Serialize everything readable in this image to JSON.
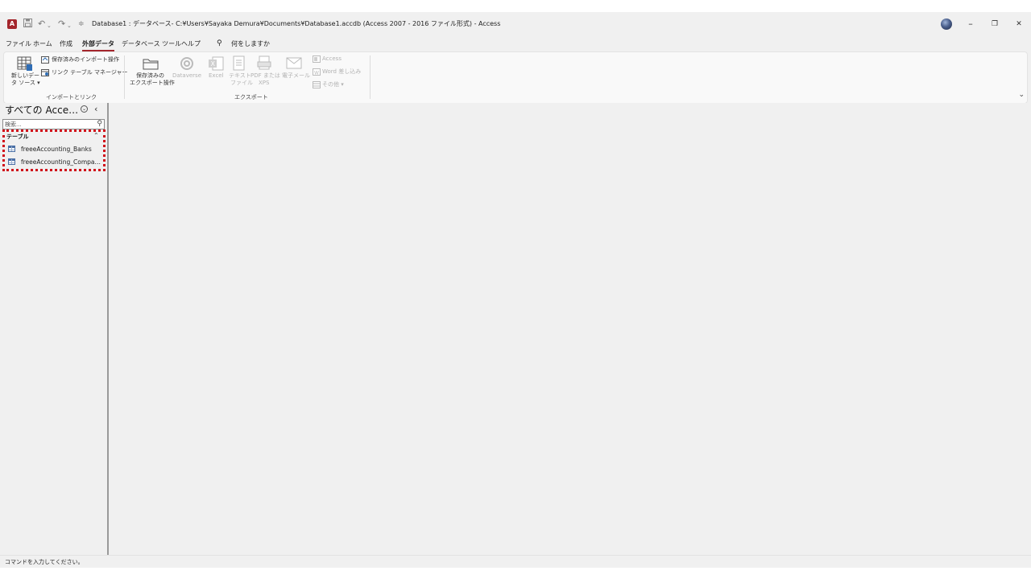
{
  "window": {
    "title": "Database1 : データベース- C:¥Users¥Sayaka Demura¥Documents¥Database1.accdb (Access 2007 - 2016 ファイル形式)  -  Access",
    "app_icon_letter": "A",
    "min_icon": "–",
    "restore_icon": "❐",
    "close_icon": "✕"
  },
  "quick_access": {
    "save_icon": "save-icon",
    "undo_icon": "undo-icon",
    "redo_icon": "redo-icon",
    "customize_icon": "customize-icon"
  },
  "menu": {
    "tabs": [
      {
        "label": "ファイル"
      },
      {
        "label": "ホーム"
      },
      {
        "label": "作成"
      },
      {
        "label": "外部データ"
      },
      {
        "label": "データベース ツール"
      },
      {
        "label": "ヘルプ"
      }
    ],
    "active_tab": "外部データ",
    "search_label": "何をしますか"
  },
  "ribbon": {
    "import_group": {
      "new_source_line1": "新しいデー",
      "new_source_line2": "タ ソース ▾",
      "saved_imports": "保存済みのインポート操作",
      "linked_table_manager": "リンク テーブル マネージャー",
      "label": "インポートとリンク"
    },
    "export_group": {
      "saved_exports_line1": "保存済みの",
      "saved_exports_line2": "エクスポート操作",
      "dataverse": "Dataverse",
      "excel": "Excel",
      "text_line1": "テキスト",
      "text_line2": "ファイル",
      "pdf_line1": "PDF または",
      "pdf_line2": "XPS",
      "email": "電子メール",
      "access": "Access",
      "word_merge": "Word 差し込み",
      "more": "その他 ▾",
      "label": "エクスポート"
    }
  },
  "nav": {
    "title": "すべての Acce…",
    "collapse_icon": "‹",
    "search_placeholder": "検索...",
    "group_header": "テーブル",
    "group_chevron": "⌃",
    "items": [
      {
        "label": "freeeAccounting_Banks"
      },
      {
        "label": "freeeAccounting_Compa…"
      }
    ]
  },
  "status": {
    "text": "コマンドを入力してください。"
  },
  "colors": {
    "accent": "#a4262c",
    "highlight": "#d0101a",
    "background": "#f0f0f0"
  }
}
